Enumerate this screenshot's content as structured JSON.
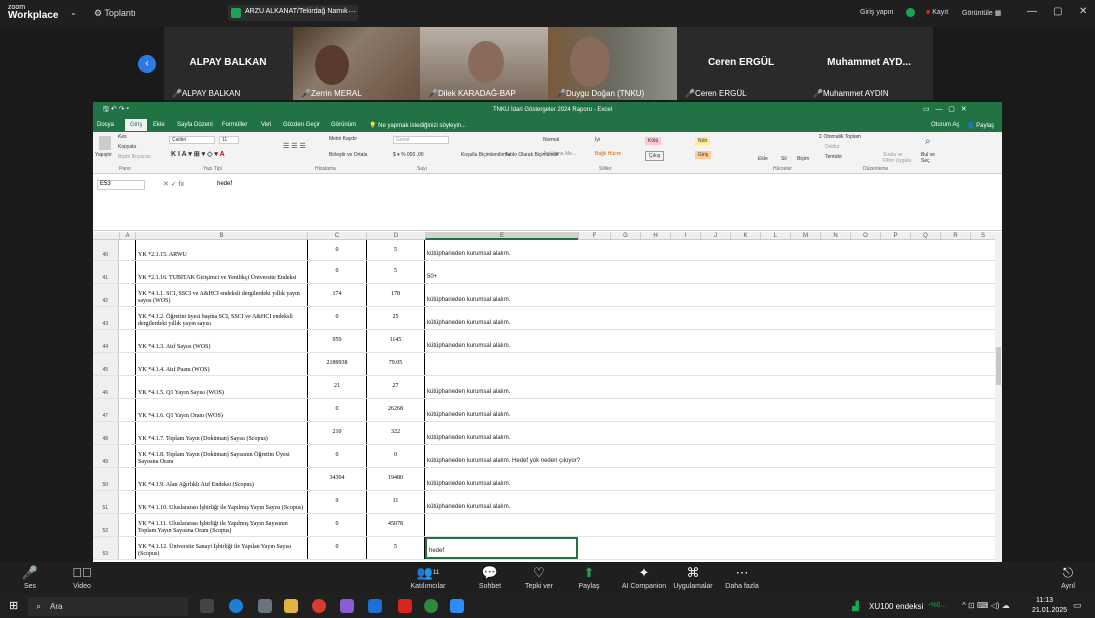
{
  "zoom": {
    "logo_top": "zoom",
    "logo_bottom": "Workplace",
    "meetings_label": "Toplantı",
    "share_banner": "ARZU ALKANAT/Tekirdağ Namık",
    "signin": "Giriş yapın",
    "record": "Kayıt",
    "view": "Görüntüle"
  },
  "participants": [
    {
      "name": "ALPAY BALKAN",
      "label": "ALPAY BALKAN",
      "video": false
    },
    {
      "name": "",
      "label": "Zerrin MERAL",
      "video": true
    },
    {
      "name": "",
      "label": "Dilek KARADAĞ-BAP",
      "video": true
    },
    {
      "name": "",
      "label": "Duygu Doğan (TNKU)",
      "video": true
    },
    {
      "name": "Ceren ERGÜL",
      "label": "Ceren ERGÜL",
      "video": false
    },
    {
      "name": "Muhammet AYD...",
      "label": "Muhammet AYDIN",
      "video": false
    }
  ],
  "excel": {
    "title": "TNKU İdari Göstergeler 2024 Raporu - Excel",
    "tabs": [
      "Dosya",
      "Giriş",
      "Ekle",
      "Sayfa Düzeni",
      "Formüller",
      "Veri",
      "Gözden Geçir",
      "Görünüm"
    ],
    "tell_me": "Ne yapmak istediğinizi söyleyin...",
    "account": "Oturum Aç",
    "share": "Paylaş",
    "ribbon": {
      "cut": "Kes",
      "copy": "Kopyala",
      "format_painter": "Biçim Boyacısı",
      "paste": "Yapıştır",
      "font": "Calibri",
      "size": "11",
      "wrap": "Metni Kaydır",
      "merge": "Birleştir ve Ortala",
      "number_format": "Genel",
      "styles": [
        "Normal",
        "İyi",
        "Kötü",
        "Nötr",
        "Açıklama Me...",
        "Bağlı Hücre",
        "Çıkış",
        "Giriş"
      ],
      "insert": "Ekle",
      "delete": "Sil",
      "format": "Biçim",
      "autosum": "Otomatik Toplam",
      "fill": "Doldur",
      "clear": "Temizle",
      "sort": "Sırala ve Filtre Uygula",
      "find": "Bul ve Seç",
      "groups": [
        "Pano",
        "Yazı Tipi",
        "Hizalama",
        "Sayı",
        "Stiller",
        "Hücreler",
        "Düzenleme"
      ],
      "cond_format": "Koşullu Biçimlendirme",
      "table_format": "Tablo Olarak Biçimlendir"
    },
    "name_box": "E53",
    "formula": "hedef",
    "columns": [
      "A",
      "B",
      "C",
      "D",
      "E",
      "F",
      "G",
      "H",
      "I",
      "J",
      "K",
      "L",
      "M",
      "N",
      "O",
      "P",
      "Q",
      "R",
      "S"
    ],
    "rows": [
      {
        "n": "40",
        "b": "YK *2.1.15. ARWU",
        "c": "0",
        "d": "5",
        "e": "kütüphaneden kurumsal alalım."
      },
      {
        "n": "41",
        "b": "YK *2.1.16. TUBİTAK Girişimci ve Yenilikçi Üniversite Endeksi",
        "c": "0",
        "d": "5",
        "e": "50+"
      },
      {
        "n": "42",
        "b": "YK *4.1.1. SCI, SSCI ve A&HCI endeksli dergilerdeki yıllık yayın sayısı (WOS)",
        "c": "174",
        "d": "178",
        "e": "kütüphaneden kurumsal alalım."
      },
      {
        "n": "43",
        "b": "YK *4.1.2. Öğretim üyesi başına SCI, SSCI ve A&HCI endeksli dergilerdeki yıllık yayın sayısı",
        "c": "0",
        "d": "25",
        "e": "kütüphaneden kurumsal alalım."
      },
      {
        "n": "44",
        "b": "YK *4.1.3. Atıf Sayısı (WOS)",
        "c": "959",
        "d": "1145",
        "e": "kütüphaneden kurumsal alalım."
      },
      {
        "n": "45",
        "b": "YK *4.1.4. Atıf Puanı (WOS)",
        "c": "2189938",
        "d": "79.05",
        "e": ""
      },
      {
        "n": "46",
        "b": "YK *4.1.5. Q1 Yayın Sayısı (WOS)",
        "c": "21",
        "d": "27",
        "e": "kütüphaneden kurumsal alalım."
      },
      {
        "n": "47",
        "b": "YK *4.1.6. Q1 Yayın Oranı (WOS)",
        "c": "0",
        "d": "26268",
        "e": "kütüphaneden kurumsal alalım."
      },
      {
        "n": "48",
        "b": "YK *4.1.7. Toplam Yayın (Doküman) Sayısı (Scopus)",
        "c": "210",
        "d": "322",
        "e": "kütüphaneden kurumsal alalım."
      },
      {
        "n": "49",
        "b": "YK *4.1.8. Toplam Yayın (Doküman) Sayısının Öğretim Üyesi Sayısına Oranı",
        "c": "0",
        "d": "0",
        "e": "kütüphaneden kurumsal alalım. Hedef yok neden çıkıyor?"
      },
      {
        "n": "50",
        "b": "YK *4.1.9. Alan Ağırlıklı Atıf Endeksi (Scopus)",
        "c": "34304",
        "d": "19480",
        "e": "kütüphaneden kurumsal alalım."
      },
      {
        "n": "51",
        "b": "YK *4.1.10. Uluslararası İşbirliği ile Yapılmış Yayın Sayısı (Scopus)",
        "c": "9",
        "d": "11",
        "e": "kütüphaneden kurumsal alalım."
      },
      {
        "n": "52",
        "b": "YK *4.1.11. Uluslararası İşbirliği ile Yapılmış Yayın Sayısının Toplam Yayın Sayısına Oranı (Scopus)",
        "c": "0",
        "d": "45078",
        "e": ""
      },
      {
        "n": "53",
        "b": "YK *4.1.12. Üniversite Sanayi İşbirliği ile Yapılan Yayın Sayısı (Scopus)",
        "c": "0",
        "d": "5",
        "e": "hedef"
      }
    ]
  },
  "toolbar": [
    {
      "icon": "mic-off-icon",
      "label": "Ses"
    },
    {
      "icon": "video-off-icon",
      "label": "Video"
    },
    {
      "icon": "participants-icon",
      "label": "Katılımcılar",
      "count": "11"
    },
    {
      "icon": "chat-icon",
      "label": "Sohbet"
    },
    {
      "icon": "react-icon",
      "label": "Tepki ver"
    },
    {
      "icon": "share-icon",
      "label": "Paylaş"
    },
    {
      "icon": "ai-icon",
      "label": "AI Companion"
    },
    {
      "icon": "apps-icon",
      "label": "Uygulamalar"
    },
    {
      "icon": "more-icon",
      "label": "Daha fazla"
    },
    {
      "icon": "leave-icon",
      "label": "Ayrıl"
    }
  ],
  "taskbar": {
    "search": "Ara",
    "stock": "XU100 endeksi",
    "stock_change": "-%0...",
    "time": "11:13",
    "date": "21.01.2025"
  },
  "colors": {
    "excel_green": "#217346",
    "zoom_green": "#1ea354",
    "record_red": "#e02828"
  }
}
